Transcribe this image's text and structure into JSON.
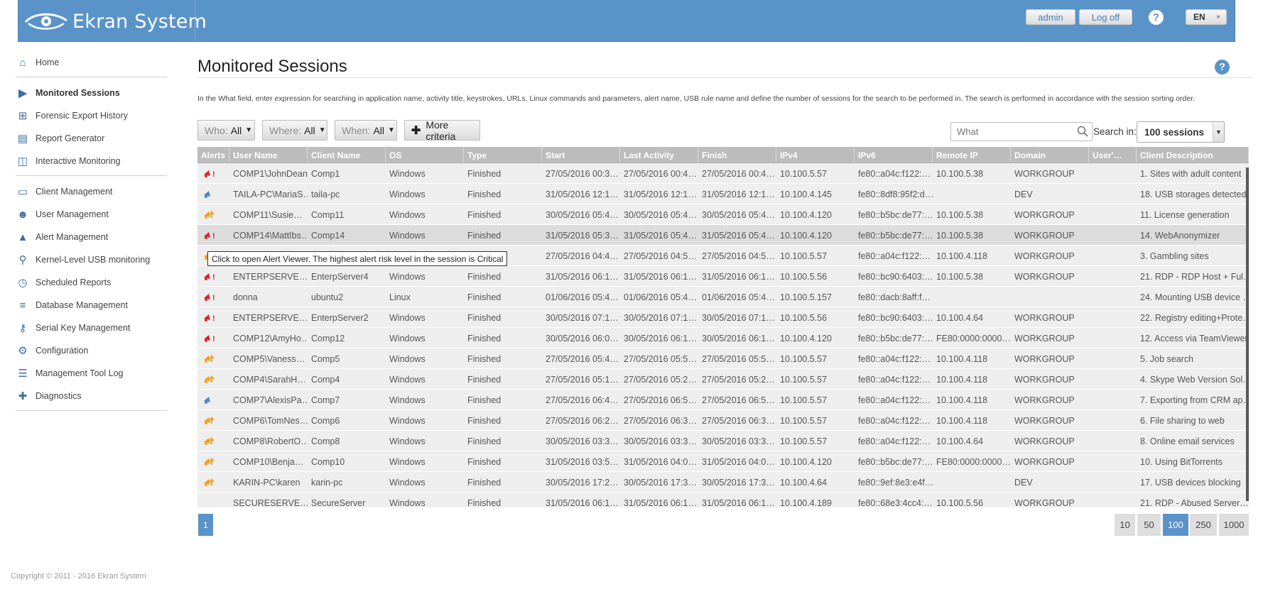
{
  "header": {
    "logo_text": "Ekran System",
    "admin_label": "admin",
    "logoff_label": "Log off",
    "lang": "EN"
  },
  "sidebar": {
    "groups": [
      [
        {
          "label": "Home",
          "icon": "home-icon"
        }
      ],
      [
        {
          "label": "Monitored Sessions",
          "icon": "monitor-icon",
          "active": true
        },
        {
          "label": "Forensic Export History",
          "icon": "export-icon"
        },
        {
          "label": "Report Generator",
          "icon": "report-icon"
        },
        {
          "label": "Interactive Monitoring",
          "icon": "chart-icon"
        }
      ],
      [
        {
          "label": "Client Management",
          "icon": "computer-icon"
        },
        {
          "label": "User Management",
          "icon": "users-icon"
        },
        {
          "label": "Alert Management",
          "icon": "alert-icon"
        },
        {
          "label": "Kernel-Level USB monitoring",
          "icon": "usb-icon"
        },
        {
          "label": "Scheduled Reports",
          "icon": "schedule-icon"
        },
        {
          "label": "Database Management",
          "icon": "database-icon"
        },
        {
          "label": "Serial Key Management",
          "icon": "key-icon"
        },
        {
          "label": "Configuration",
          "icon": "gear-icon"
        },
        {
          "label": "Management Tool Log",
          "icon": "log-icon"
        },
        {
          "label": "Diagnostics",
          "icon": "diagnostics-icon"
        }
      ]
    ]
  },
  "main": {
    "title": "Monitored Sessions",
    "description": "In the What field, enter expression for searching in application name, activity title, keystrokes, URLs, Linux commands and parameters, alert name, USB rule name and define the number of sessions for the search to be performed in. The search is performed in accordance with the session sorting order."
  },
  "filters": {
    "who_label": "Who:",
    "who_value": "All",
    "where_label": "Where:",
    "where_value": "All",
    "when_label": "When:",
    "when_value": "All",
    "more_label": "More criteria",
    "search_placeholder": "What",
    "search_in_label": "Search in:",
    "search_in_value": "100 sessions"
  },
  "table": {
    "columns": [
      "Alerts",
      "User Name",
      "Client Name",
      "OS",
      "Type",
      "Start",
      "Last Activity",
      "Finish",
      "IPv4",
      "IPv6",
      "Remote IP",
      "Domain",
      "User'…",
      "Client Description"
    ],
    "rows": [
      {
        "alert": "red",
        "cells": [
          "COMP1\\JohnDean",
          "Comp1",
          "Windows",
          "Finished",
          "27/05/2016 00:3…",
          "27/05/2016 00:4…",
          "27/05/2016 00:4…",
          "10.100.5.57",
          "fe80::a04c:f122:…",
          "10.100.5.38",
          "WORKGROUP",
          "",
          "1. Sites with adult content"
        ]
      },
      {
        "alert": "blue",
        "cells": [
          "TAILA-PC\\MariaS…",
          "taila-pc",
          "Windows",
          "Finished",
          "31/05/2016 12:1…",
          "31/05/2016 12:1…",
          "31/05/2016 12:1…",
          "10.100.4.145",
          "fe80::8df8:95f2:d…",
          "",
          "DEV",
          "",
          "18. USB storages detected"
        ]
      },
      {
        "alert": "orange",
        "cells": [
          "COMP11\\Susie…",
          "Comp11",
          "Windows",
          "Finished",
          "30/05/2016 05:4…",
          "30/05/2016 05:4…",
          "30/05/2016 05:4…",
          "10.100.4.120",
          "fe80::b5bc:de77:…",
          "10.100.5.38",
          "WORKGROUP",
          "",
          "11. License generation"
        ]
      },
      {
        "alert": "red",
        "hl": true,
        "cells": [
          "COMP14\\MattIbs…",
          "Comp14",
          "Windows",
          "Finished",
          "31/05/2016 05:3…",
          "31/05/2016 05:4…",
          "31/05/2016 05:4…",
          "10.100.4.120",
          "fe80::b5bc:de77:…",
          "10.100.5.38",
          "WORKGROUP",
          "",
          "14. WebAnonymizer"
        ]
      },
      {
        "alert": "orange",
        "cells": [
          "",
          "",
          "",
          "",
          "27/05/2016 04:4…",
          "27/05/2016 04:5…",
          "27/05/2016 04:5…",
          "10.100.5.57",
          "fe80::a04c:f122:…",
          "10.100.4.118",
          "WORKGROUP",
          "",
          "3. Gambling sites"
        ]
      },
      {
        "alert": "red",
        "cells": [
          "ENTERPSERVE…",
          "EnterpServer4",
          "Windows",
          "Finished",
          "31/05/2016 06:1…",
          "31/05/2016 06:1…",
          "31/05/2016 06:1…",
          "10.100.5.56",
          "fe80::bc90:6403:…",
          "10.100.5.38",
          "WORKGROUP",
          "",
          "21. RDP - RDP Host + Ful…"
        ]
      },
      {
        "alert": "red",
        "cells": [
          "donna",
          "ubuntu2",
          "Linux",
          "Finished",
          "01/06/2016 05:4…",
          "01/06/2016 05:4…",
          "01/06/2016 05:4…",
          "10.100.5.157",
          "fe80::dacb:8aff:f…",
          "",
          "",
          "",
          "24. Mounting USB device …"
        ]
      },
      {
        "alert": "red",
        "cells": [
          "ENTERPSERVE…",
          "EnterpServer2",
          "Windows",
          "Finished",
          "30/05/2016 07:1…",
          "30/05/2016 07:1…",
          "30/05/2016 07:1…",
          "10.100.5.56",
          "fe80::bc90:6403:…",
          "10.100.4.64",
          "WORKGROUP",
          "",
          "22. Registry editing+Prote…"
        ]
      },
      {
        "alert": "red",
        "cells": [
          "COMP12\\AmyHo…",
          "Comp12",
          "Windows",
          "Finished",
          "30/05/2016 06:0…",
          "30/05/2016 06:1…",
          "30/05/2016 06:1…",
          "10.100.4.120",
          "fe80::b5bc:de77:…",
          "FE80:0000:0000…",
          "WORKGROUP",
          "",
          "12. Access via TeamViewer"
        ]
      },
      {
        "alert": "orange",
        "cells": [
          "COMP5\\Vaness…",
          "Comp5",
          "Windows",
          "Finished",
          "27/05/2016 05:4…",
          "27/05/2016 05:5…",
          "27/05/2016 05:5…",
          "10.100.5.57",
          "fe80::a04c:f122:…",
          "10.100.4.118",
          "WORKGROUP",
          "",
          "5. Job search"
        ]
      },
      {
        "alert": "orange",
        "cells": [
          "COMP4\\SarahH…",
          "Comp4",
          "Windows",
          "Finished",
          "27/05/2016 05:1…",
          "27/05/2016 05:2…",
          "27/05/2016 05:2…",
          "10.100.5.57",
          "fe80::a04c:f122:…",
          "10.100.4.118",
          "WORKGROUP",
          "",
          "4. Skype Web Version Sol…"
        ]
      },
      {
        "alert": "blue",
        "cells": [
          "COMP7\\AlexisPa…",
          "Comp7",
          "Windows",
          "Finished",
          "27/05/2016 06:4…",
          "27/05/2016 06:5…",
          "27/05/2016 06:5…",
          "10.100.5.57",
          "fe80::a04c:f122:…",
          "10.100.4.118",
          "WORKGROUP",
          "",
          "7. Exporting from CRM ap…"
        ]
      },
      {
        "alert": "orange",
        "cells": [
          "COMP6\\TomNes…",
          "Comp6",
          "Windows",
          "Finished",
          "27/05/2016 06:2…",
          "27/05/2016 06:3…",
          "27/05/2016 06:3…",
          "10.100.5.57",
          "fe80::a04c:f122:…",
          "10.100.4.118",
          "WORKGROUP",
          "",
          "6. File sharing to web"
        ]
      },
      {
        "alert": "orange",
        "cells": [
          "COMP8\\RobertO…",
          "Comp8",
          "Windows",
          "Finished",
          "30/05/2016 03:3…",
          "30/05/2016 03:3…",
          "30/05/2016 03:3…",
          "10.100.5.57",
          "fe80::a04c:f122:…",
          "10.100.4.64",
          "WORKGROUP",
          "",
          "8. Online email services"
        ]
      },
      {
        "alert": "orange",
        "cells": [
          "COMP10\\Benja…",
          "Comp10",
          "Windows",
          "Finished",
          "31/05/2016 03:5…",
          "31/05/2016 04:0…",
          "31/05/2016 04:0…",
          "10.100.4.120",
          "fe80::b5bc:de77:…",
          "FE80:0000:0000…",
          "WORKGROUP",
          "",
          "10. Using BitTorrents"
        ]
      },
      {
        "alert": "orange",
        "cells": [
          "KARIN-PC\\karen",
          "karin-pc",
          "Windows",
          "Finished",
          "30/05/2016 17:2…",
          "30/05/2016 17:3…",
          "30/05/2016 17:3…",
          "10.100.4.64",
          "fe80::9ef:8e3:e4f…",
          "",
          "DEV",
          "",
          "17. USB devices blocking"
        ]
      },
      {
        "alert": "none",
        "cells": [
          "SECURESERVE…",
          "SecureServer",
          "Windows",
          "Finished",
          "31/05/2016 06:1…",
          "31/05/2016 06:1…",
          "31/05/2016 06:1…",
          "10.100.4.189",
          "fe80::68e3:4cc4:…",
          "10.100.5.56",
          "WORKGROUP",
          "",
          "21. RDP - Abused Server…"
        ]
      }
    ],
    "tooltip": "Click to open Alert Viewer. The highest alert risk level in the session is Critical"
  },
  "pagination": {
    "current_page": "1",
    "page_sizes": [
      "10",
      "50",
      "100",
      "250",
      "1000"
    ],
    "active_size": "100"
  },
  "footer": {
    "copyright": "Copyright © 2011 - 2016 Ekran System"
  },
  "colors": {
    "accent": "#5a93c8",
    "alert_red": "#d9262f",
    "alert_orange": "#f4a21c",
    "alert_blue": "#4b86c6"
  }
}
